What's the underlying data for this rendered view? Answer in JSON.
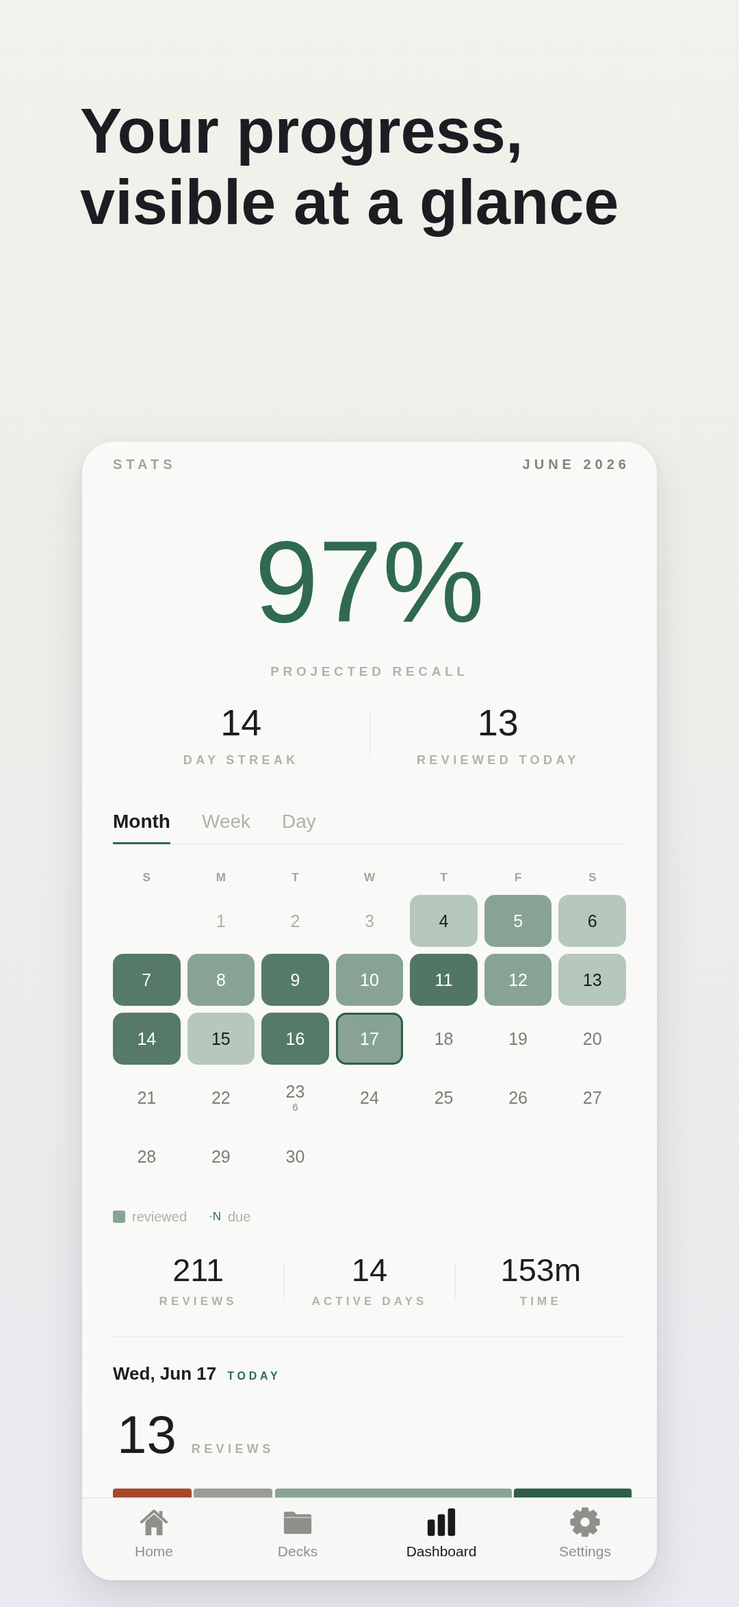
{
  "headline": {
    "lines": [
      "Your progress,",
      "visible at a glance"
    ]
  },
  "header": {
    "title": "STATS",
    "period": "JUNE 2026"
  },
  "recall": {
    "value": "97%",
    "label": "PROJECTED RECALL"
  },
  "summary": [
    {
      "value": "14",
      "label": "DAY STREAK"
    },
    {
      "value": "13",
      "label": "REVIEWED TODAY"
    }
  ],
  "tabs": [
    {
      "label": "Month",
      "selected": true
    },
    {
      "label": "Week",
      "selected": false
    },
    {
      "label": "Day",
      "selected": false
    }
  ],
  "calendar": {
    "weekdays": [
      "S",
      "M",
      "T",
      "W",
      "T",
      "F",
      "S"
    ],
    "weeks": [
      [
        {
          "kind": "blank"
        },
        {
          "label": "1",
          "kind": "past",
          "selected": false
        },
        {
          "label": "2",
          "kind": "past",
          "selected": false
        },
        {
          "label": "3",
          "kind": "past",
          "selected": false
        },
        {
          "label": "4",
          "kind": "reviewed",
          "color": "#b6c7bc",
          "selected": false
        },
        {
          "label": "5",
          "kind": "reviewed",
          "color": "#88a396",
          "selected": false
        },
        {
          "label": "6",
          "kind": "reviewed",
          "color": "#b6c7bc",
          "selected": false
        }
      ],
      [
        {
          "label": "7",
          "kind": "reviewed",
          "color": "#567a68",
          "selected": false
        },
        {
          "label": "8",
          "kind": "reviewed",
          "color": "#88a396",
          "selected": false
        },
        {
          "label": "9",
          "kind": "reviewed",
          "color": "#567a68",
          "selected": false
        },
        {
          "label": "10",
          "kind": "reviewed",
          "color": "#88a396",
          "selected": false
        },
        {
          "label": "11",
          "kind": "reviewed",
          "color": "#527664",
          "selected": false
        },
        {
          "label": "12",
          "kind": "reviewed",
          "color": "#88a396",
          "selected": false
        },
        {
          "label": "13",
          "kind": "reviewed",
          "color": "#b6c7bc",
          "selected": false
        }
      ],
      [
        {
          "label": "14",
          "kind": "reviewed",
          "color": "#567a68",
          "selected": false
        },
        {
          "label": "15",
          "kind": "reviewed",
          "color": "#b6c7bc",
          "selected": false
        },
        {
          "label": "16",
          "kind": "reviewed",
          "color": "#567a68",
          "selected": false
        },
        {
          "label": "17",
          "kind": "reviewed",
          "color": "#88a396",
          "selected": true
        },
        {
          "label": "18",
          "kind": "future",
          "selected": false
        },
        {
          "label": "19",
          "kind": "future",
          "selected": false
        },
        {
          "label": "20",
          "kind": "future",
          "selected": false
        }
      ],
      [
        {
          "label": "21",
          "kind": "future",
          "selected": false
        },
        {
          "label": "22",
          "kind": "future",
          "selected": false
        },
        {
          "label": "23",
          "kind": "future",
          "due": "6",
          "selected": false
        },
        {
          "label": "24",
          "kind": "future",
          "selected": false
        },
        {
          "label": "25",
          "kind": "future",
          "selected": false
        },
        {
          "label": "26",
          "kind": "future",
          "selected": false
        },
        {
          "label": "27",
          "kind": "future",
          "selected": false
        }
      ],
      [
        {
          "label": "28",
          "kind": "future",
          "selected": false
        },
        {
          "label": "29",
          "kind": "future",
          "selected": false
        },
        {
          "label": "30",
          "kind": "future",
          "selected": false
        }
      ]
    ]
  },
  "legend": [
    {
      "kind": "swatch",
      "color": "#88a396",
      "label": "reviewed"
    },
    {
      "kind": "marker",
      "marker": "·N",
      "label": "due"
    }
  ],
  "totals": [
    {
      "value": "211",
      "label": "REVIEWS"
    },
    {
      "value": "14",
      "label": "ACTIVE DAYS"
    },
    {
      "value": "153m",
      "label": "TIME"
    }
  ],
  "day_detail": {
    "date": "Wed, Jun 17",
    "badge": "TODAY",
    "count": "13",
    "unit": "REVIEWS"
  },
  "nav": [
    {
      "label": "Home",
      "selected": false
    },
    {
      "label": "Decks",
      "selected": false
    },
    {
      "label": "Dashboard",
      "selected": true
    },
    {
      "label": "Settings",
      "selected": false
    }
  ]
}
